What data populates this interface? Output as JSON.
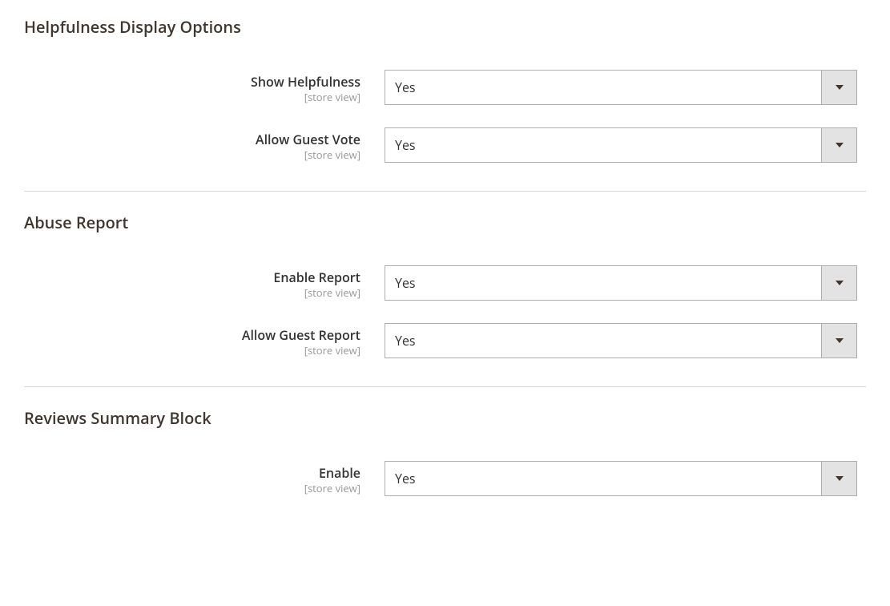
{
  "sections": {
    "helpfulness": {
      "title": "Helpfulness Display Options",
      "fields": {
        "show_helpfulness": {
          "label": "Show Helpfulness",
          "scope": "[store view]",
          "value": "Yes"
        },
        "allow_guest_vote": {
          "label": "Allow Guest Vote",
          "scope": "[store view]",
          "value": "Yes"
        }
      }
    },
    "abuse": {
      "title": "Abuse Report",
      "fields": {
        "enable_report": {
          "label": "Enable Report",
          "scope": "[store view]",
          "value": "Yes"
        },
        "allow_guest_report": {
          "label": "Allow Guest Report",
          "scope": "[store view]",
          "value": "Yes"
        }
      }
    },
    "summary": {
      "title": "Reviews Summary Block",
      "fields": {
        "enable": {
          "label": "Enable",
          "scope": "[store view]",
          "value": "Yes"
        }
      }
    }
  }
}
